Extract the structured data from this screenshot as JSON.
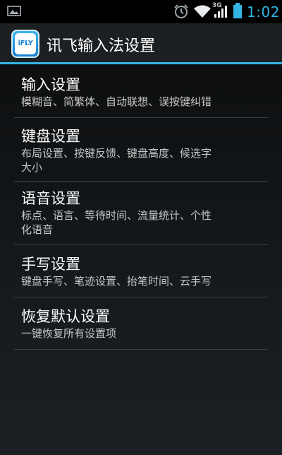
{
  "status_bar": {
    "network": "3G",
    "time": "1:02",
    "icons": [
      "photo-icon",
      "alarm-clock-icon",
      "wifi-icon",
      "signal-icon",
      "battery-icon"
    ]
  },
  "action_bar": {
    "logo_text": "iFLY",
    "title": "讯飞输入法设置"
  },
  "settings": [
    {
      "title": "输入设置",
      "subtitle": [
        "模糊音、简繁体、自动联想、误按键纠错"
      ]
    },
    {
      "title": "键盘设置",
      "subtitle": [
        "布局设置、按键反馈、键盘高度、候选字",
        "大小"
      ]
    },
    {
      "title": "语音设置",
      "subtitle": [
        "标点、语言、等待时间、流量统计、个性",
        "化语音"
      ]
    },
    {
      "title": "手写设置",
      "subtitle": [
        "键盘手写、笔迹设置、抬笔时间、云手写"
      ]
    },
    {
      "title": "恢复默认设置",
      "subtitle": [
        "一键恢复所有设置项"
      ]
    }
  ],
  "colors": {
    "accent": "#33b5e5",
    "background": "#14181b",
    "text_primary": "#ffffff",
    "text_secondary": "#c7c7c7"
  }
}
